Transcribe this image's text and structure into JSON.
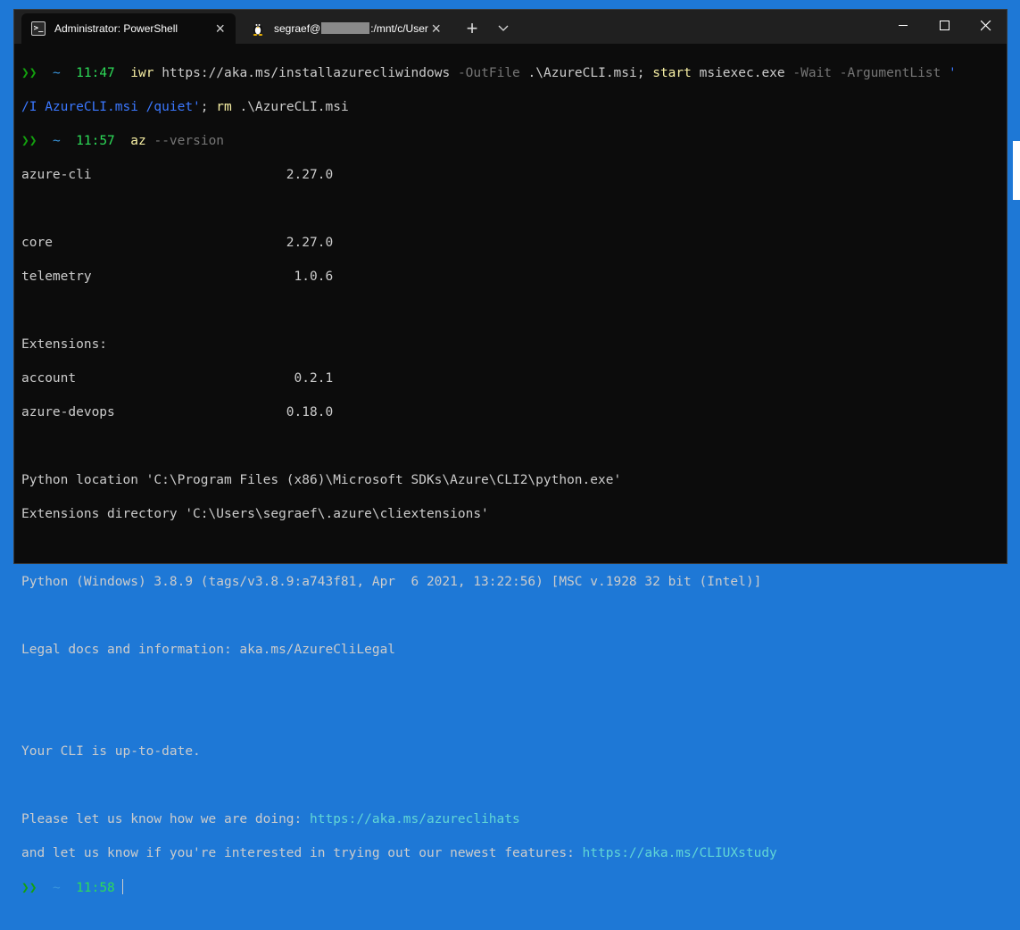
{
  "tabs": [
    {
      "label": "Administrator: PowerShell",
      "icon": "powershell-icon",
      "active": true
    },
    {
      "label_prefix": "segraef@",
      "label_suffix": ":/mnt/c/User",
      "icon": "linux-penguin-icon",
      "active": false
    }
  ],
  "colors": {
    "background": "#0c0c0c",
    "titlebar": "#202020",
    "desktop": "#1e78d6",
    "prompt_green": "#16c60c",
    "time_green": "#2ddb58",
    "command_yellow": "#f9f1a5",
    "url_cyan": "#61d6d6",
    "string_blue": "#3b78ff"
  },
  "terminal": {
    "prompt_glyph": "❯❯",
    "tilde": "~",
    "line1": {
      "time": "11:47",
      "cmd1": "iwr",
      "url": "https://aka.ms/installazurecliwindows",
      "param1": "-OutFile",
      "path1": ".\\AzureCLI.msi;",
      "cmd2": "start",
      "exe": "msiexec.exe",
      "param2": "-Wait",
      "param3": "-ArgumentList",
      "quote_open": "'",
      "arg_str": "/I AzureCLI.msi /quiet'",
      "semi": ";",
      "cmd3": "rm",
      "path2": ".\\AzureCLI.msi"
    },
    "line2": {
      "time": "11:57",
      "cmd": "az",
      "param": "--version"
    },
    "output": [
      "azure-cli                         2.27.0",
      "",
      "core                              2.27.0",
      "telemetry                          1.0.6",
      "",
      "Extensions:",
      "account                            0.2.1",
      "azure-devops                      0.18.0",
      "",
      "Python location 'C:\\Program Files (x86)\\Microsoft SDKs\\Azure\\CLI2\\python.exe'",
      "Extensions directory 'C:\\Users\\segraef\\.azure\\cliextensions'",
      "",
      "Python (Windows) 3.8.9 (tags/v3.8.9:a743f81, Apr  6 2021, 13:22:56) [MSC v.1928 32 bit (Intel)]",
      "",
      "Legal docs and information: aka.ms/AzureCliLegal",
      "",
      "",
      "Your CLI is up-to-date.",
      ""
    ],
    "feedback1_text": "Please let us know how we are doing: ",
    "feedback1_url": "https://aka.ms/azureclihats",
    "feedback2_text": "and let us know if you're interested in trying out our newest features: ",
    "feedback2_url": "https://aka.ms/CLIUXstudy",
    "line3": {
      "time": "11:58"
    }
  }
}
